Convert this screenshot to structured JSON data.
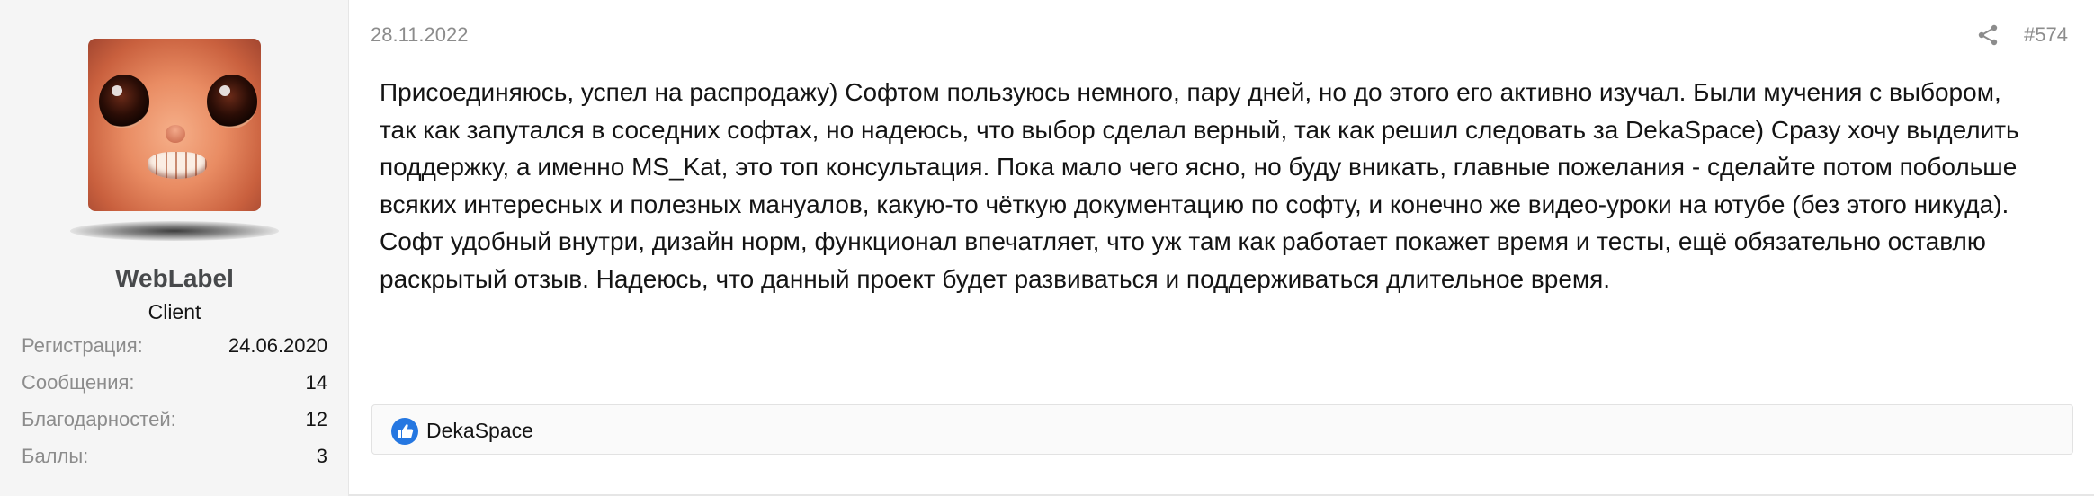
{
  "post": {
    "date": "28.11.2022",
    "number": "#574",
    "body": "Присоединяюсь, успел на распродажу) Софтом пользуюсь немного, пару дней, но до этого его активно изучал. Были мучения с выбором, так как запутался в соседних софтах, но надеюсь, что выбор сделал верный, так как решил следовать за DekaSpace) Сразу хочу выделить поддержку, а именно MS_Kat, это топ консультация. Пока мало чего ясно, но буду вникать, главные пожелания - сделайте потом побольше всяких интересных и полезных мануалов, какую-то чёткую документацию по софту, и конечно же видео-уроки на ютубе (без этого никуда). Софт удобный внутри, дизайн норм, функционал впечатляет, что уж там как работает покажет время и тесты, ещё обязательно оставлю раскрытый отзыв. Надеюсь, что данный проект будет развиваться и поддерживаться длительное время."
  },
  "user": {
    "name": "WebLabel",
    "title": "Client",
    "stats": [
      {
        "label": "Регистрация:",
        "value": "24.06.2020"
      },
      {
        "label": "Сообщения:",
        "value": "14"
      },
      {
        "label": "Благодарностей:",
        "value": "12"
      },
      {
        "label": "Баллы:",
        "value": "3"
      }
    ]
  },
  "reactions": {
    "icon": "like-icon",
    "users": "DekaSpace"
  },
  "icons": {
    "share": "share-icon",
    "like": "like-icon"
  },
  "colors": {
    "sidebar_bg": "#f5f5f5",
    "muted_text": "#8c8c8c",
    "like_blue": "#2577e1"
  }
}
